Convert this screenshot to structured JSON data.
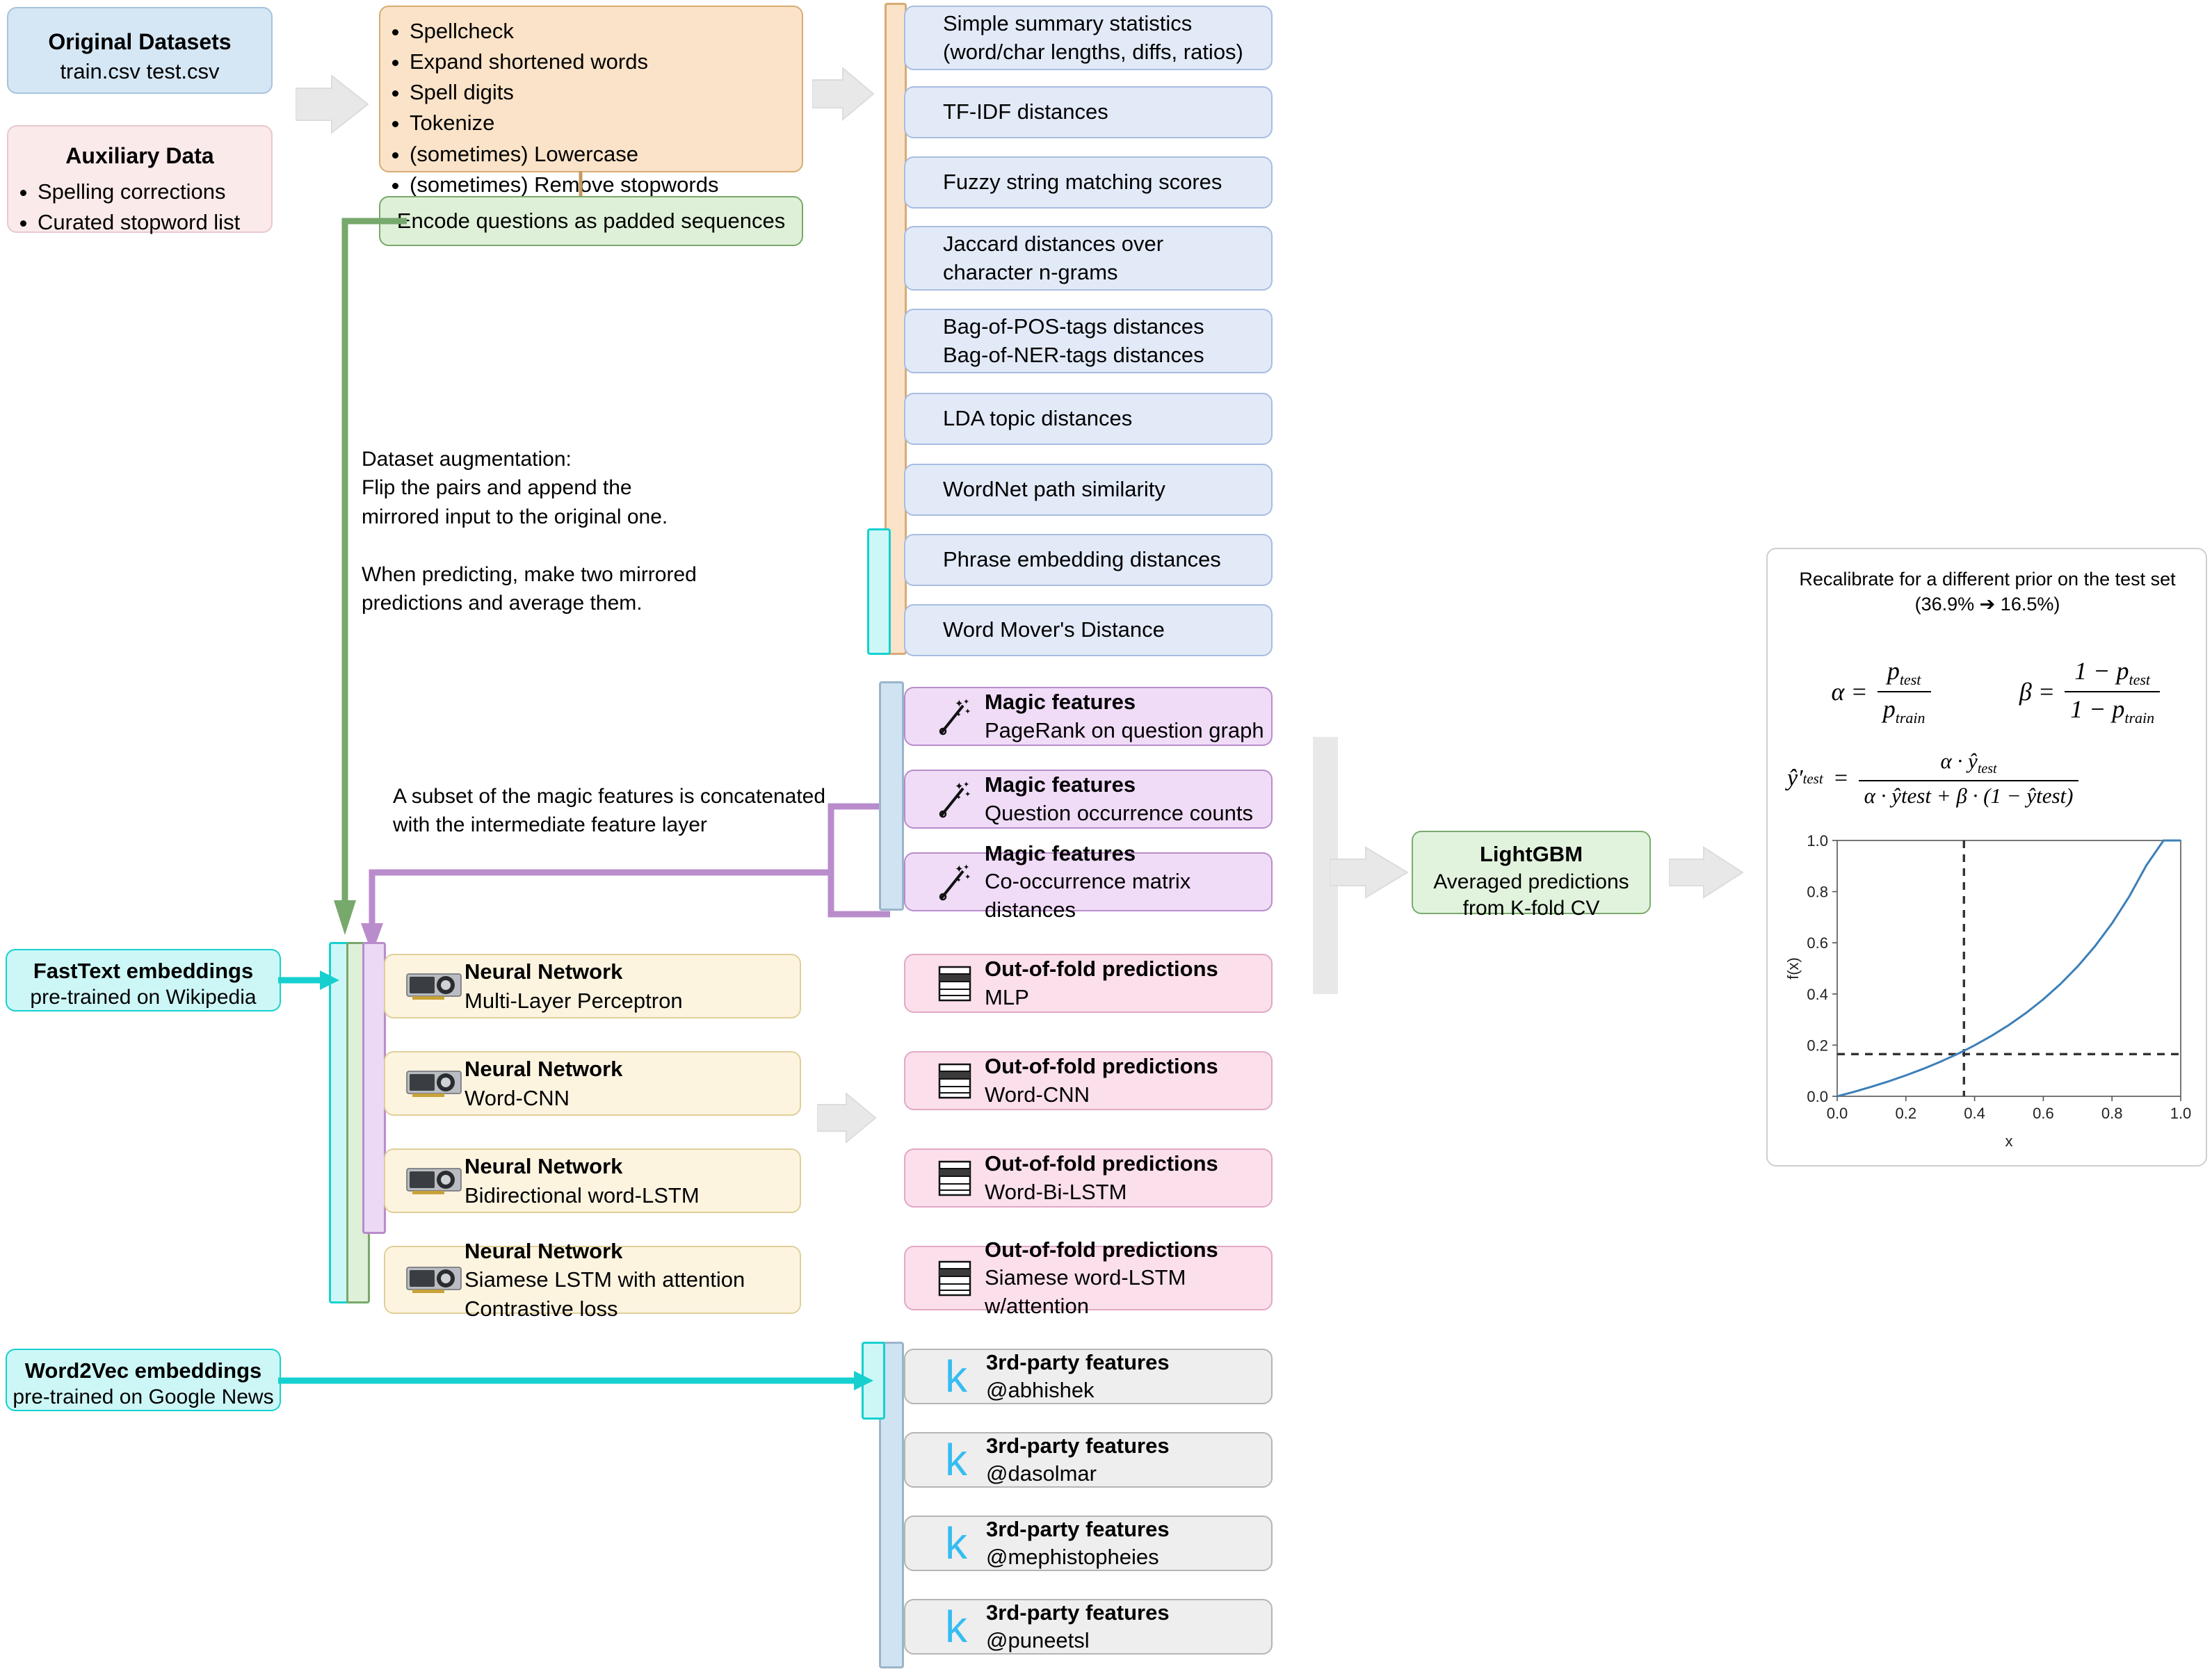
{
  "inputs": {
    "original": {
      "title": "Original Datasets",
      "files": "train.csv   test.csv"
    },
    "auxiliary": {
      "title": "Auxiliary Data",
      "items": [
        "Spelling corrections",
        "Curated stopword list"
      ]
    }
  },
  "preprocess": {
    "steps": [
      "Spellcheck",
      "Expand shortened words",
      "Spell digits",
      "Tokenize",
      "(sometimes) Lowercase",
      "(sometimes) Remove stopwords"
    ],
    "encode_label": "Encode questions as padded sequences"
  },
  "notes": {
    "augmentation": "Dataset augmentation:\nFlip the pairs and append the\nmirrored input to the original one.\n\nWhen predicting, make two mirrored\npredictions and average them.",
    "magic_subset": "A subset of the magic features is concatenated\nwith the intermediate feature layer"
  },
  "features": [
    {
      "text": "Simple summary statistics\n(word/char lengths, diffs, ratios)"
    },
    {
      "text": "TF-IDF distances"
    },
    {
      "text": "Fuzzy string matching scores"
    },
    {
      "text": "Jaccard distances over\ncharacter n-grams"
    },
    {
      "text": "Bag-of-POS-tags distances\nBag-of-NER-tags distances"
    },
    {
      "text": "LDA topic distances"
    },
    {
      "text": "WordNet path similarity"
    },
    {
      "text": "Phrase embedding distances"
    },
    {
      "text": "Word Mover's Distance"
    }
  ],
  "magic_features": [
    {
      "title": "Magic features",
      "sub": "PageRank on question graph"
    },
    {
      "title": "Magic features",
      "sub": "Question occurrence counts"
    },
    {
      "title": "Magic features",
      "sub": "Co-occurrence matrix distances"
    }
  ],
  "neural_networks": [
    {
      "title": "Neural Network",
      "sub": "Multi-Layer Perceptron"
    },
    {
      "title": "Neural Network",
      "sub": "Word-CNN"
    },
    {
      "title": "Neural Network",
      "sub": "Bidirectional word-LSTM"
    },
    {
      "title": "Neural Network",
      "sub": "Siamese LSTM with attention\nContrastive loss"
    }
  ],
  "oof_predictions": [
    {
      "title": "Out-of-fold predictions",
      "sub": "MLP"
    },
    {
      "title": "Out-of-fold predictions",
      "sub": "Word-CNN"
    },
    {
      "title": "Out-of-fold predictions",
      "sub": "Word-Bi-LSTM"
    },
    {
      "title": "Out-of-fold predictions",
      "sub": "Siamese word-LSTM w/attention"
    }
  ],
  "third_party": [
    {
      "title": "3rd-party features",
      "sub": "@abhishek",
      "logo": "k"
    },
    {
      "title": "3rd-party features",
      "sub": "@dasolmar",
      "logo": "k"
    },
    {
      "title": "3rd-party features",
      "sub": "@mephistopheies",
      "logo": "k"
    },
    {
      "title": "3rd-party features",
      "sub": "@puneetsl",
      "logo": "k"
    }
  ],
  "embeddings": {
    "fasttext": {
      "title": "FastText embeddings",
      "sub": "pre-trained on Wikipedia"
    },
    "word2vec": {
      "title": "Word2Vec embeddings",
      "sub": "pre-trained on Google News"
    }
  },
  "model": {
    "title": "LightGBM",
    "sub": "Averaged predictions\nfrom K-fold CV"
  },
  "recalibration": {
    "title": "Recalibrate for a different prior on the test set",
    "subtitle": "(36.9% ➔ 16.5%)",
    "alpha_lhs": "α =",
    "alpha_num": "p",
    "alpha_num_sub": "test",
    "alpha_den": "p",
    "alpha_den_sub": "train",
    "beta_lhs": "β =",
    "beta_num": "1 − p",
    "beta_num_sub": "test",
    "beta_den": "1 − p",
    "beta_den_sub": "train",
    "y_lhs": "ŷ′",
    "y_lhs_sub": "test",
    "y_eq": "=",
    "y_num": "α · ŷ",
    "y_num_sub": "test",
    "y_den": "α · ŷtest + β · (1 − ŷtest)"
  },
  "colors": {
    "dataset_blue": "#d5e7f5",
    "aux_pink": "#fbeaea",
    "preprocess_orange": "#fae3c8",
    "encode_green": "#dff0d8",
    "feature_blue": "#e2eaf8",
    "magic_purple": "#f0dcf7",
    "oof_pink": "#fbdfeb",
    "nn_cream": "#fdf4e0",
    "third_gray": "#eeeeee",
    "embed_cyan": "#cdf7f7",
    "model_green": "#e1f3dd",
    "arrow_gray": "#e8e8e8",
    "curve_blue": "#3c7fb8",
    "kaggle_blue": "#35bdf2"
  },
  "chart_data": {
    "type": "line",
    "title": "",
    "xlabel": "x",
    "ylabel": "f(x)",
    "xlim": [
      0.0,
      1.0
    ],
    "ylim": [
      0.0,
      1.0
    ],
    "xticks": [
      "0.0",
      "0.2",
      "0.4",
      "0.6",
      "0.8",
      "1.0"
    ],
    "yticks": [
      "0.0",
      "0.2",
      "0.4",
      "0.6",
      "0.8",
      "1.0"
    ],
    "grid": false,
    "annotations": [
      {
        "type": "vline",
        "x": 0.369,
        "style": "dashed"
      },
      {
        "type": "hline",
        "y": 0.165,
        "style": "dashed"
      }
    ],
    "series": [
      {
        "name": "recalibration curve",
        "x": [
          0.0,
          0.05,
          0.1,
          0.15,
          0.2,
          0.25,
          0.3,
          0.35,
          0.369,
          0.4,
          0.45,
          0.5,
          0.55,
          0.6,
          0.65,
          0.7,
          0.75,
          0.8,
          0.85,
          0.9,
          0.95,
          1.0
        ],
        "y": [
          0.0,
          0.0179,
          0.0374,
          0.0586,
          0.0818,
          0.1071,
          0.1349,
          0.1655,
          0.1779,
          0.1993,
          0.2369,
          0.2789,
          0.326,
          0.3791,
          0.4392,
          0.5076,
          0.5859,
          0.676,
          0.7805,
          0.9027,
          1.0,
          1.0
        ]
      }
    ]
  }
}
